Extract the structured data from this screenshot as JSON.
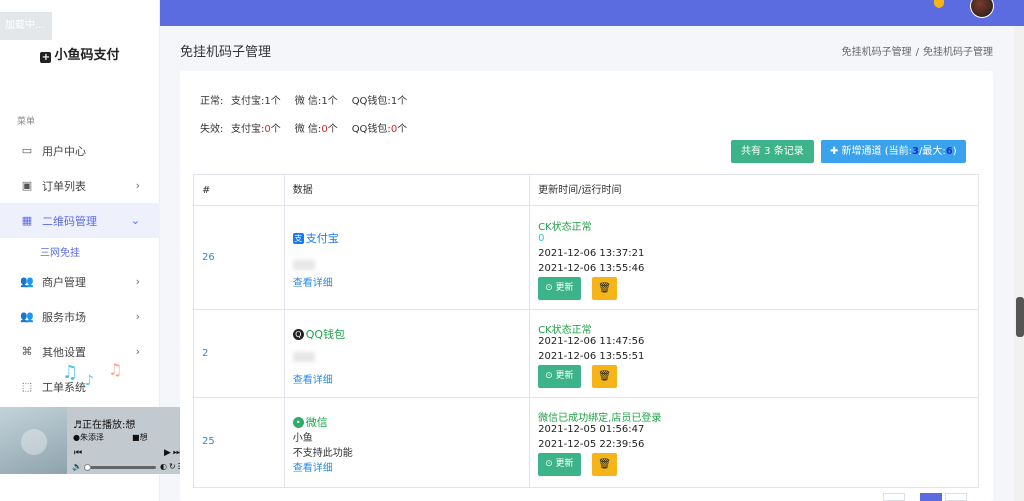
{
  "loading": "加载中...",
  "brand": {
    "name": "小鱼码支付"
  },
  "menu": {
    "caption": "菜单",
    "items": [
      {
        "label": "用户中心",
        "icon": "monitor-icon"
      },
      {
        "label": "订单列表",
        "icon": "order-icon"
      },
      {
        "label": "二维码管理",
        "icon": "qrcode-icon"
      },
      {
        "label": "商户管理",
        "icon": "users-icon"
      },
      {
        "label": "服务市场",
        "icon": "users-icon"
      },
      {
        "label": "其他设置",
        "icon": "command-icon"
      },
      {
        "label": "工单系统",
        "icon": "ticket-icon"
      }
    ],
    "sub_item": "三网免挂"
  },
  "player": {
    "title": "正在播放:想",
    "artist": "朱添泽",
    "album": "想"
  },
  "header": {
    "title": "免挂机码子管理",
    "breadcrumb": [
      "免挂机码子管理",
      "免挂机码子管理"
    ],
    "breadcrumb_sep": "/"
  },
  "stats": {
    "normal": {
      "label": "正常:",
      "alipay": "支付宝:",
      "alipay_n": "1",
      "wechat": "微 信:",
      "wechat_n": "1",
      "qq": "QQ钱包:",
      "qq_n": "1",
      "unit": "个"
    },
    "invalid": {
      "label": "失效:",
      "alipay": "支付宝:",
      "alipay_n": "0",
      "wechat": "微 信:",
      "wechat_n": "0",
      "qq": "QQ钱包:",
      "qq_n": "0",
      "unit": "个"
    }
  },
  "actions": {
    "count": "共有 3 条记录",
    "add_prefix": "✚ 新增通道 (当前:",
    "current": "3",
    "max_label": "/最大:",
    "max": "6",
    "add_suffix": ")"
  },
  "table": {
    "headers": [
      "#",
      "数据",
      "更新时间/运行时间"
    ],
    "rows": [
      {
        "id": "26",
        "channel": "支付宝",
        "line2": "",
        "line3": "",
        "detail": "查看详细",
        "status": "CK状态正常",
        "extra": "0",
        "updated": "2021-12-06 13:37:21",
        "run": "2021-12-06 13:55:46",
        "update_btn": "更新",
        "delete_btn": "🗑"
      },
      {
        "id": "2",
        "channel": "QQ钱包",
        "line2": "",
        "line3": "",
        "detail": "查看详细",
        "status": "CK状态正常",
        "extra": "",
        "updated": "2021-12-06 11:47:56",
        "run": "2021-12-06 13:55:51",
        "update_btn": "更新",
        "delete_btn": "🗑"
      },
      {
        "id": "25",
        "channel": "微信",
        "line2": "小鱼",
        "line3": "不支持此功能",
        "detail": "查看详细",
        "status": "微信已成功绑定,店员已登录",
        "extra": "",
        "updated": "2021-12-05 01:56:47",
        "run": "2021-12-05 22:39:56",
        "update_btn": "更新",
        "delete_btn": "🗑"
      }
    ]
  },
  "colors": {
    "primary": "#5b6be0",
    "success": "#3cb389",
    "info": "#3ba3ee",
    "warning": "#f5b51a",
    "danger": "#e02020"
  }
}
